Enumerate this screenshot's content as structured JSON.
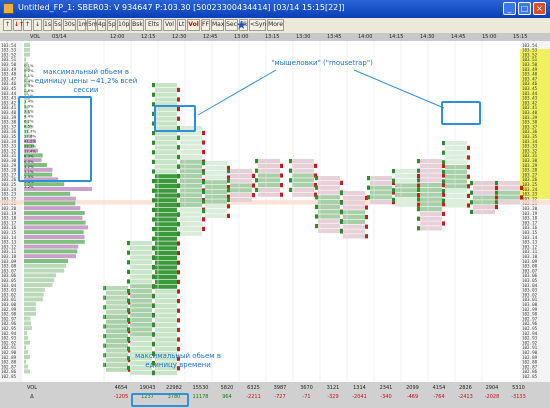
{
  "window": {
    "title": "Untitled_FP_1: SBER03: V 934647 P:103.30 [50023300434414] [03/14 15:15[22]]",
    "min_label": "_",
    "max_label": "□",
    "close_label": "×"
  },
  "toolbar": [
    {
      "label": "↑",
      "red": false
    },
    {
      "label": "↓↑",
      "red": true
    },
    {
      "label": "↑",
      "red": false
    },
    {
      "label": "↓",
      "red": false
    },
    {
      "label": "1s",
      "red": false
    },
    {
      "label": "5s",
      "red": false
    },
    {
      "label": "30s",
      "red": false
    },
    {
      "label": "1m",
      "red": false
    },
    {
      "label": "5m",
      "red": false
    },
    {
      "label": "4p",
      "red": false
    },
    {
      "label": "5p",
      "red": false
    },
    {
      "label": "10p",
      "red": false
    },
    {
      "label": "Bsk",
      "red": false
    },
    {
      "label": "Elts",
      "red": false
    },
    {
      "label": "Vol",
      "red": false
    },
    {
      "label": "Lt",
      "red": false
    },
    {
      "label": "Vol",
      "red": true
    },
    {
      "label": "FF",
      "red": false
    },
    {
      "label": "Max",
      "red": false
    },
    {
      "label": "Sec",
      "red": false
    },
    {
      "label": "Bk",
      "red": false
    },
    {
      "label": "<Syn",
      "red": false
    },
    {
      "label": "More",
      "red": false
    }
  ],
  "header": {
    "left": [
      "VOL",
      "03/14"
    ],
    "times": [
      "12:00",
      "12:15",
      "12:30",
      "12:45",
      "13:00",
      "13:15",
      "13:30",
      "13:45",
      "14:00",
      "14:15",
      "14:30",
      "14:45",
      "15:00",
      "15:15"
    ]
  },
  "prices": [
    "103.54",
    "103.53",
    "103.52",
    "103.51",
    "103.50",
    "103.49",
    "103.48",
    "103.47",
    "103.46",
    "103.45",
    "103.44",
    "103.43",
    "103.42",
    "103.41",
    "103.40",
    "103.39",
    "103.38",
    "103.37",
    "103.36",
    "103.35",
    "103.34",
    "103.33",
    "103.32",
    "103.31",
    "103.30",
    "103.29",
    "103.28",
    "103.27",
    "103.26",
    "103.25",
    "103.24",
    "103.23",
    "103.22",
    "103.21",
    "103.20",
    "103.19",
    "103.18",
    "103.17",
    "103.16",
    "103.15",
    "103.14",
    "103.13",
    "103.12",
    "103.11",
    "103.10",
    "103.09",
    "103.08",
    "103.07",
    "103.06",
    "103.05",
    "103.04",
    "103.03",
    "103.02",
    "103.01",
    "103.00",
    "102.99",
    "102.98",
    "102.97",
    "102.96",
    "102.95",
    "102.94",
    "102.93",
    "102.92",
    "102.91",
    "102.90",
    "102.89",
    "102.88",
    "102.87",
    "102.86",
    "102.85"
  ],
  "profile_pct": [
    "0.1%",
    "0.2%",
    "0.1%",
    "0.4%",
    "0.3%",
    "0.6%",
    "1.1%",
    "1.4%",
    "2.0%",
    "3.1%",
    "4.4%",
    "6.2%",
    "8.5%",
    "11.3%",
    "17.6%",
    "41.2%",
    "22.1%",
    "12.4%",
    "8.3%",
    "6.0%",
    "4.2%",
    "3.1%",
    "2.5%",
    "1.8%",
    "1.2%"
  ],
  "footer": {
    "row1_label": "VOL",
    "row2_label": "Δ",
    "volumes": [
      "4654",
      "19043",
      "22982",
      "15530",
      "5820",
      "6325",
      "3987",
      "3670",
      "3121",
      "1314",
      "2341",
      "2099",
      "4154",
      "2826",
      "2904",
      "5310"
    ],
    "deltas": [
      "-1205",
      "1237",
      "3780",
      "11178",
      "964",
      "-2211",
      "-727",
      "-71",
      "-329",
      "-2041",
      "-340",
      "-469",
      "-764",
      "-2413",
      "-2028",
      "-3133"
    ]
  },
  "annotations": {
    "max_price": "максимальный обьем в единицу цены  ~41,2% всей сессии",
    "mousetrap": "\"мышеловки\" (\"mousetrap\")",
    "max_time": "максимальный обьем в единицу времени"
  }
}
